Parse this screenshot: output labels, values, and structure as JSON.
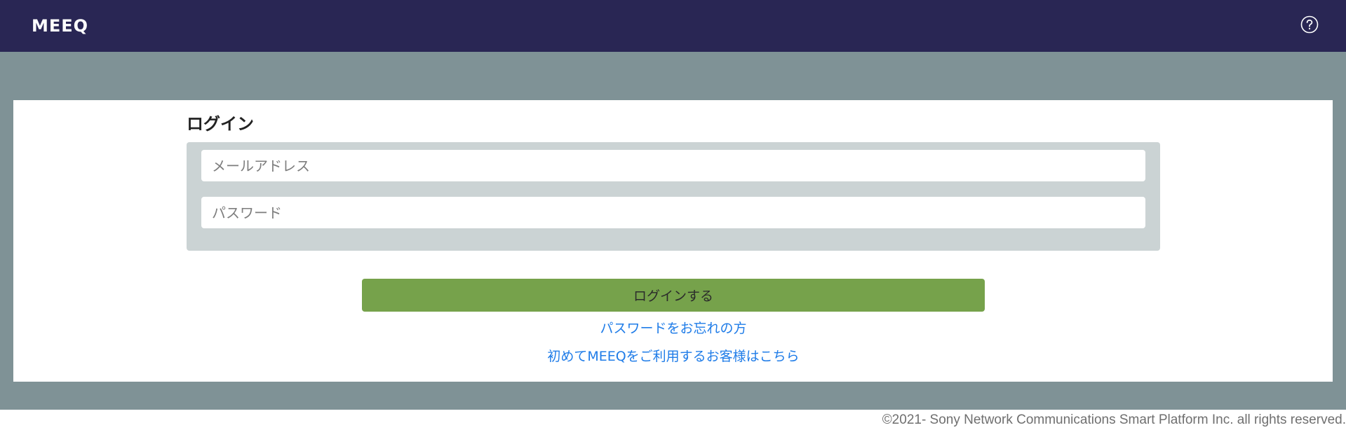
{
  "header": {
    "logo": "MEEQ",
    "help_icon": "question-circle-icon"
  },
  "login": {
    "title": "ログイン",
    "email_placeholder": "メールアドレス",
    "password_placeholder": "パスワード",
    "submit_label": "ログインする",
    "forgot_password_link": "パスワードをお忘れの方",
    "signup_link": "初めてMEEQをご利用するお客様はこちら"
  },
  "footer": {
    "copyright": "©2021- Sony Network Communications Smart Platform Inc. all rights reserved."
  },
  "colors": {
    "header_bg": "#292654",
    "page_bg": "#7f9296",
    "panel_bg": "#cbd3d4",
    "button_bg": "#76a24b",
    "link": "#1f7ce8"
  }
}
